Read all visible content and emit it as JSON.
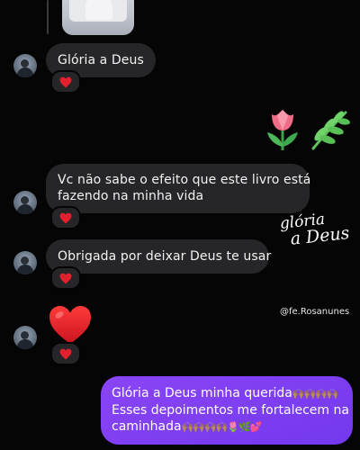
{
  "chat": {
    "messages": [
      {
        "sender": "other",
        "text": "Glória a Deus",
        "reaction": "❤️"
      },
      {
        "sender": "other",
        "text_line1": "Vc não sabe o efeito que este livro está",
        "text_line2": "fazendo na minha vida",
        "reaction": "❤️"
      },
      {
        "sender": "other",
        "text": "Obrigada por deixar Deus te usar",
        "reaction": "❤️"
      },
      {
        "sender": "other",
        "emoji": "❤️",
        "reaction": "❤️"
      },
      {
        "sender": "me",
        "line1": "Glória a Deus minha querida",
        "line1_emoji": "🙌🏽🙌🏽🙌🏽🙌🏽",
        "line2": "Esses depoimentos me fortalecem na",
        "line3": "caminhada",
        "line3_emoji": "🙌🏽🙌🏽🙌🏽🙌🏽🌷🌿💕"
      }
    ]
  },
  "overlay": {
    "script_line1": "glória",
    "script_line2": "a Deus",
    "handle": "@fe.Rosanunes"
  },
  "stickers": [
    "tulip-icon",
    "leaf-icon"
  ],
  "colors": {
    "background": "#050506",
    "incoming_bubble": "#262628",
    "outgoing_bubble": "#7a3ff0",
    "heart": "#e3202d"
  }
}
